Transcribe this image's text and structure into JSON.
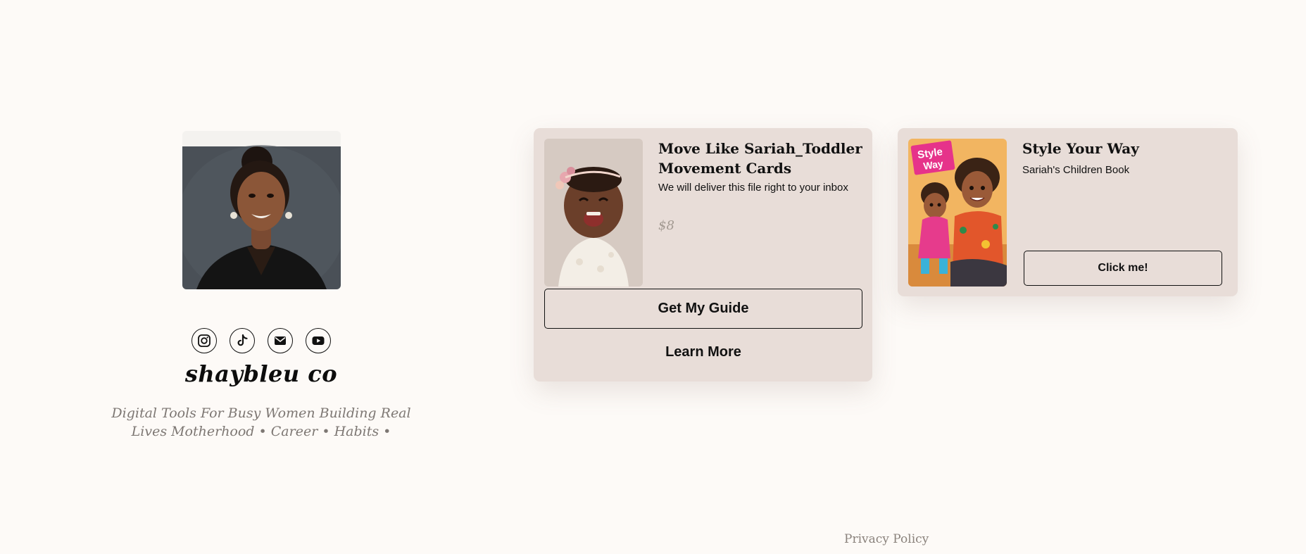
{
  "profile": {
    "name": "shaybleu co",
    "tagline": "Digital Tools For Busy Women Building Real Lives Motherhood • Career • Habits •",
    "socials": [
      {
        "icon": "instagram-icon"
      },
      {
        "icon": "tiktok-icon"
      },
      {
        "icon": "email-icon"
      },
      {
        "icon": "youtube-icon"
      }
    ]
  },
  "products": [
    {
      "title": "Move Like Sariah_Toddler Movement Cards",
      "description": "We will deliver this file right to your inbox",
      "price": "$8",
      "primary_button": "Get My Guide",
      "secondary_link": "Learn More"
    },
    {
      "title": "Style Your Way",
      "description": "Sariah's Children Book",
      "cover_text_line1": "Style",
      "cover_text_line2": "Way",
      "primary_button": "Click me!"
    }
  ],
  "footer": {
    "privacy_link": "Privacy Policy"
  },
  "colors": {
    "page_background": "#fdfaf7",
    "card_background": "#e8ddd8",
    "accent_text": "#7d7773"
  }
}
